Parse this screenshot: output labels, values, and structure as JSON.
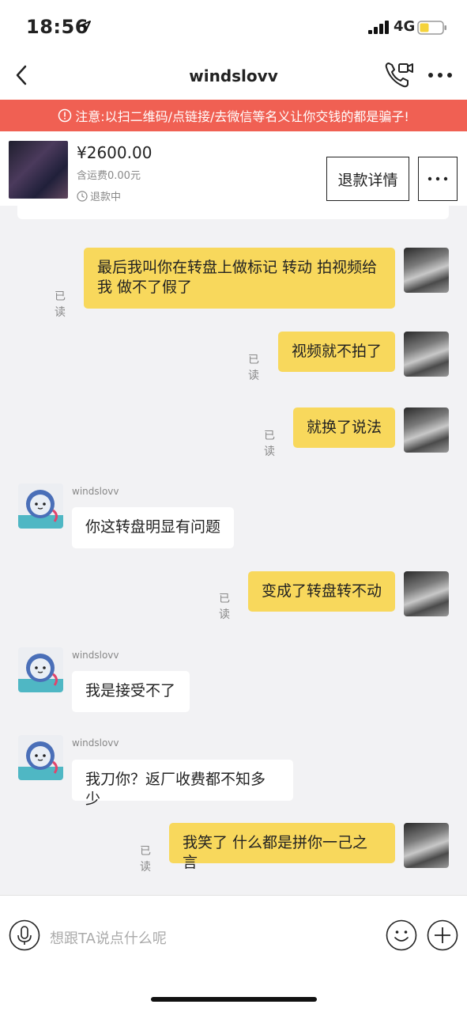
{
  "status": {
    "time": "18:56",
    "network": "4G",
    "battery_color": "#f5d33b"
  },
  "nav": {
    "title": "windslovv"
  },
  "warning": {
    "text": "注意:以扫二维码/点链接/去微信等名义让你交钱的都是骗子!"
  },
  "product": {
    "price": "¥2600.00",
    "shipping": "含运费0.00元",
    "state": "退款中",
    "refund_button": "退款详情"
  },
  "messages": {
    "m1": {
      "text": "最后我叫你在转盘上做标记 转动 拍视频给我 做不了假了",
      "read": "已读"
    },
    "m2": {
      "text": "视频就不拍了",
      "read": "已读"
    },
    "m3": {
      "text": "就换了说法",
      "read": "已读"
    },
    "m4": {
      "sender": "windslovv",
      "text": "你这转盘明显有问题"
    },
    "m5": {
      "text": "变成了转盘转不动",
      "read": "已读"
    },
    "m6": {
      "sender": "windslovv",
      "text": "我是接受不了"
    },
    "m7": {
      "sender": "windslovv",
      "text": "我刀你？返厂收费都不知多少"
    },
    "m8": {
      "text": "我笑了 什么都是拼你一己之言",
      "read": "已读"
    }
  },
  "input": {
    "placeholder": "想跟TA说点什么呢"
  },
  "colors": {
    "my_bubble": "#f8d85c",
    "warning_bg": "#f06053",
    "background": "#f2f2f4"
  }
}
